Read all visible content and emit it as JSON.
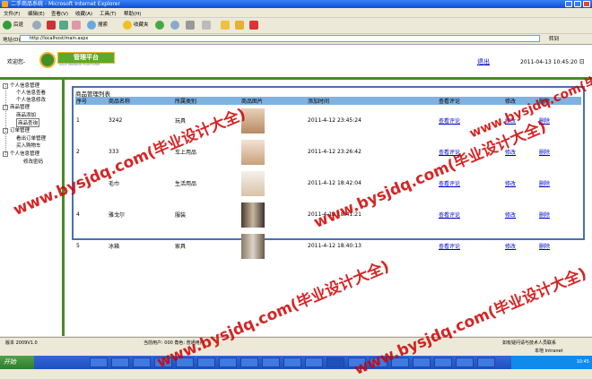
{
  "window": {
    "title": "二手商品系统 - Microsoft Internet Explorer"
  },
  "menu": [
    "文件(F)",
    "编辑(E)",
    "查看(V)",
    "收藏(A)",
    "工具(T)",
    "帮助(H)"
  ],
  "toolbar": {
    "back": "后退",
    "search": "搜索",
    "favorites": "收藏夹"
  },
  "address": {
    "label": "地址(D)",
    "url": "http://localhost/main.aspx",
    "go": "转到"
  },
  "header": {
    "welcome": "欢迎您-",
    "logo_text": "管理平台",
    "logo_sub": "SALE MANAGE PLATFORM",
    "logout": "退出",
    "date": "2011-04-13 10:45:20 日"
  },
  "sidebar": {
    "groups": [
      {
        "label": "个人信息管理",
        "items": [
          "个人信息查看",
          "个人信息修改"
        ]
      },
      {
        "label": "商品管理",
        "items": [
          "商品添加",
          "商品查询"
        ]
      },
      {
        "label": "订单管理",
        "items": [
          "看出订单管理",
          "买入购物车"
        ]
      },
      {
        "label": "个人信息管理",
        "items": [
          "修改密码"
        ]
      }
    ]
  },
  "panel": {
    "title": "商品管理列表",
    "columns": [
      "序号",
      "商品名称",
      "所属类别",
      "商品图片",
      "添加时间",
      "",
      "修改",
      "删除"
    ],
    "rows": [
      {
        "no": "1",
        "name": "3242",
        "category": "玩具",
        "time": "2011-4-12 23:45:24",
        "view": "查看评论",
        "edit": "修改",
        "del": "删除"
      },
      {
        "no": "2",
        "name": "333",
        "category": "车上用品",
        "time": "2011-4-12 23:26:42",
        "view": "查看评论",
        "edit": "修改",
        "del": "删除"
      },
      {
        "no": "3",
        "name": "毛巾",
        "category": "生活用品",
        "time": "2011-4-12 18:42:04",
        "view": "查看评论",
        "edit": "修改",
        "del": "删除"
      },
      {
        "no": "4",
        "name": "雅戈尔",
        "category": "服装",
        "time": "2011-4-12 18:41:21",
        "view": "查看评论",
        "edit": "修改",
        "del": "删除"
      },
      {
        "no": "5",
        "name": "冰箱",
        "category": "家具",
        "time": "2011-4-12 18:40:13",
        "view": "查看评论",
        "edit": "修改",
        "del": "删除"
      }
    ],
    "view_header": "查看评论"
  },
  "statusbar": {
    "left": "版本 2009V1.0",
    "middle": "当前用户: 000 角色: 普通用户",
    "right": "如有疑问请与技术人员联系",
    "zone": "本地 Intranet"
  },
  "taskbar": {
    "start": "开始",
    "time": "10:45"
  },
  "watermark": {
    "text": "www.bysjdq.com(毕业设计大全)"
  },
  "colors": {
    "green": "#4a8a26",
    "header_blue": "#7fb2e0",
    "link": "#0000cc",
    "watermark": "#d00000"
  }
}
